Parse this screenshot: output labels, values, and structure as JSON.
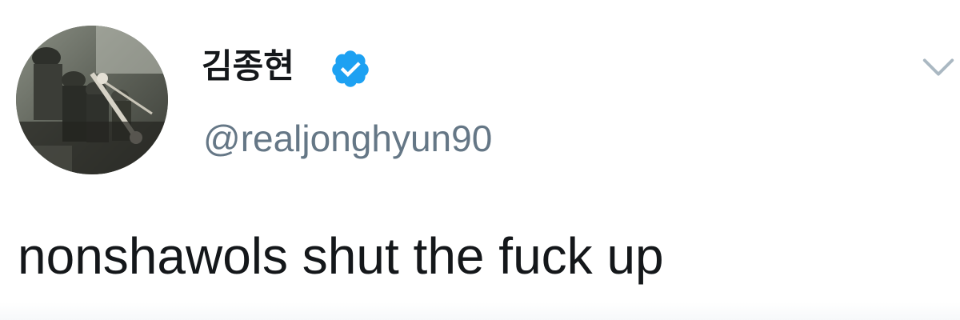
{
  "tweet": {
    "author": {
      "display_name": "김종현",
      "handle": "@realjonghyun90",
      "verified": true,
      "verified_icon": "verified-badge-icon",
      "avatar_icon": "avatar-photo"
    },
    "text": "nonshawols shut the fuck up",
    "menu_icon": "chevron-down-icon"
  },
  "colors": {
    "text_primary": "#14171a",
    "text_secondary": "#657786",
    "verified_blue": "#1da1f2",
    "caret_gray": "#aab8c2",
    "background": "#ffffff"
  }
}
